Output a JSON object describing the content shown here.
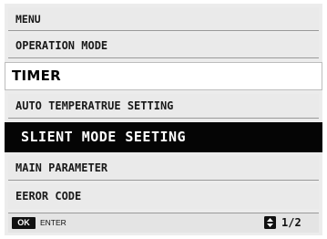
{
  "menu": {
    "title": "MENU",
    "items": [
      {
        "label": "OPERATION MODE",
        "state": "normal"
      },
      {
        "label": "TIMER",
        "state": "focused"
      },
      {
        "label": "AUTO TEMPERATRUE SETTING",
        "state": "normal"
      },
      {
        "label": "SLIENT MODE SEETING",
        "state": "selected"
      },
      {
        "label": "MAIN PARAMETER",
        "state": "normal"
      },
      {
        "label": "EEROR CODE",
        "state": "normal"
      }
    ]
  },
  "footer": {
    "ok_label": "OK",
    "enter_label": "ENTER",
    "page_indicator": "1/2",
    "updown_icon": "up-down-arrows-icon"
  },
  "colors": {
    "panel_background": "#ececec",
    "selected_background": "#050505",
    "selected_text": "#ffffff",
    "focused_background": "#ffffff"
  }
}
